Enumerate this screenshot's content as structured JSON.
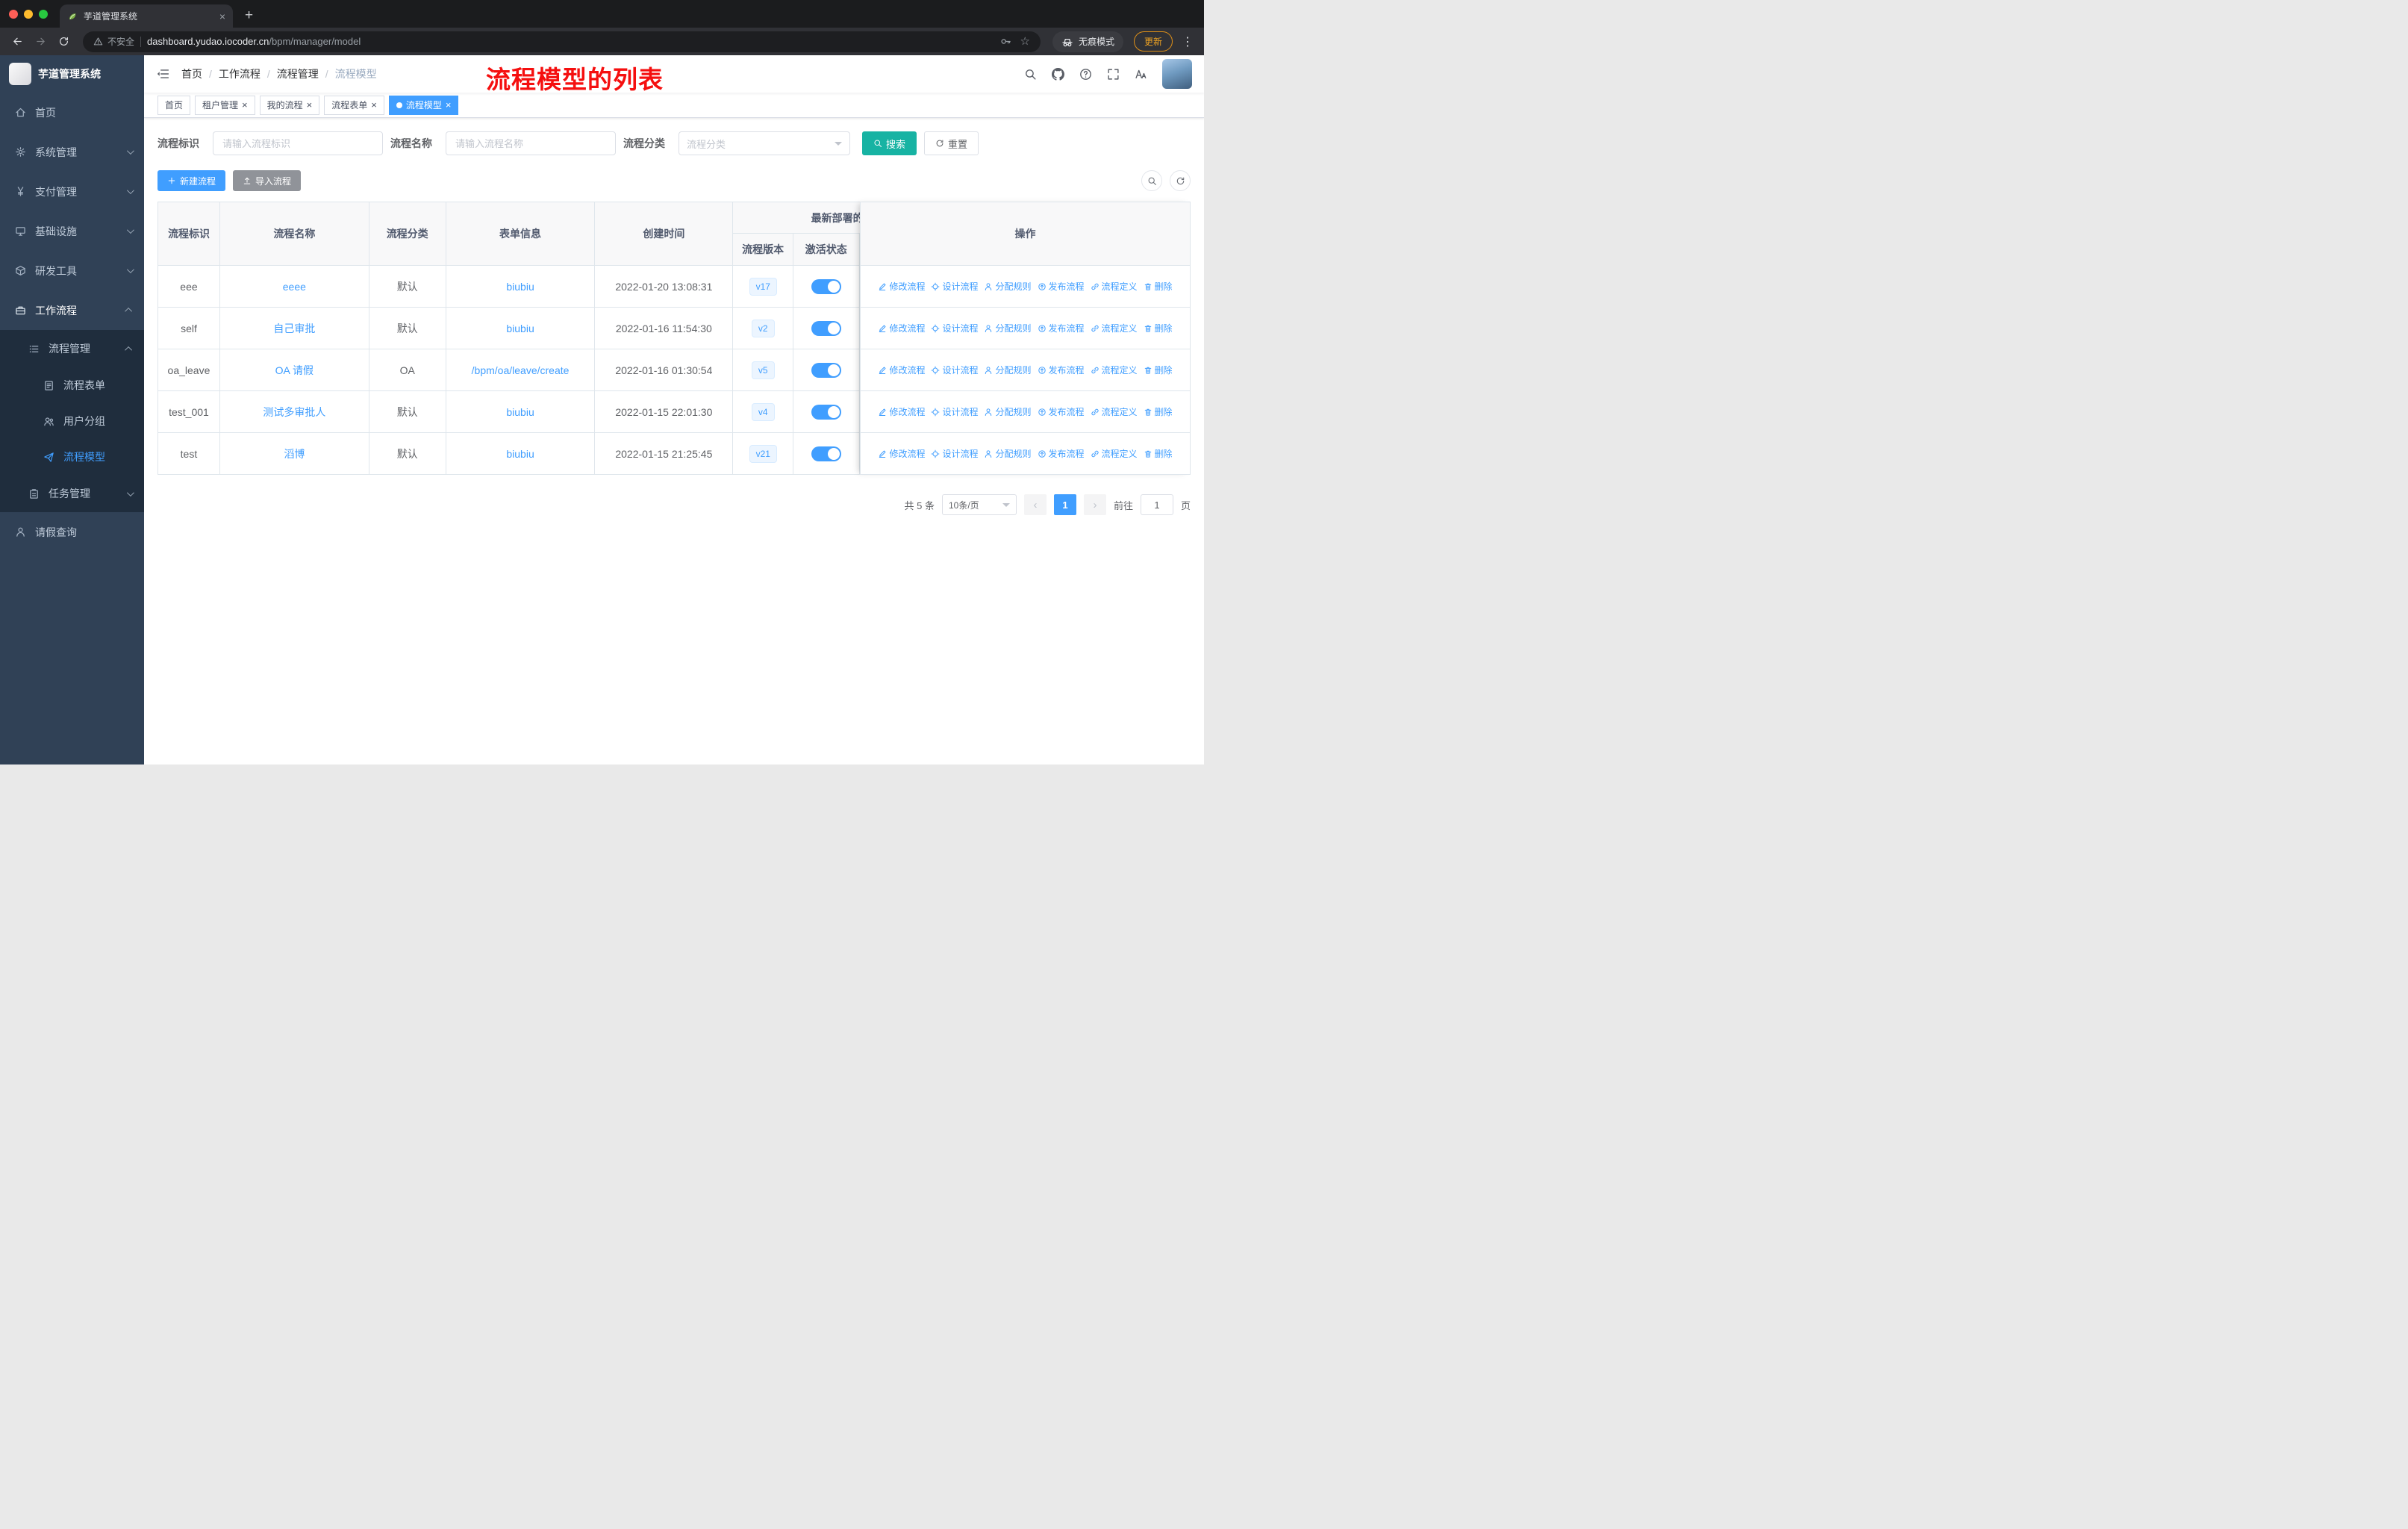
{
  "browser": {
    "tab_title": "芋道管理系统",
    "security_label": "不安全",
    "url_host": "dashboard.yudao.iocoder.cn",
    "url_path": "/bpm/manager/model",
    "incognito_label": "无痕模式",
    "update_label": "更新"
  },
  "colors": {
    "primary": "#409eff",
    "search_button": "#17b3a3",
    "annotation_red": "#f50f0f",
    "update_orange": "#f0a423",
    "sidebar_bg": "#304156",
    "submenu_bg": "#1f2d3d"
  },
  "sidebar": {
    "logo_text": "芋道管理系统",
    "menu": [
      {
        "label": "首页",
        "icon": "home",
        "level": 1
      },
      {
        "label": "系统管理",
        "icon": "gear",
        "level": 1,
        "arrow": "down"
      },
      {
        "label": "支付管理",
        "icon": "yen",
        "level": 1,
        "arrow": "down"
      },
      {
        "label": "基础设施",
        "icon": "infra",
        "level": 1,
        "arrow": "down"
      },
      {
        "label": "研发工具",
        "icon": "tools",
        "level": 1,
        "arrow": "down"
      },
      {
        "label": "工作流程",
        "icon": "work",
        "level": 1,
        "arrow": "up",
        "highlight": true
      },
      {
        "label": "流程管理",
        "icon": "list",
        "level": 2,
        "arrow": "up",
        "sub": true
      },
      {
        "label": "流程表单",
        "icon": "form",
        "level": 3,
        "sub": true
      },
      {
        "label": "用户分组",
        "icon": "users",
        "level": 3,
        "sub": true
      },
      {
        "label": "流程模型",
        "icon": "send",
        "level": 3,
        "sub": true,
        "active": true
      },
      {
        "label": "任务管理",
        "icon": "task",
        "level": 2,
        "arrow": "down",
        "sub": true
      },
      {
        "label": "请假查询",
        "icon": "person",
        "level": 1
      }
    ]
  },
  "header": {
    "breadcrumb": [
      "首页",
      "工作流程",
      "流程管理",
      "流程模型"
    ],
    "annotation": "流程模型的列表",
    "icons": [
      "search",
      "github",
      "question",
      "fullscreen",
      "fontsize"
    ]
  },
  "tags_view": [
    {
      "label": "首页"
    },
    {
      "label": "租户管理",
      "closable": true
    },
    {
      "label": "我的流程",
      "closable": true
    },
    {
      "label": "流程表单",
      "closable": true
    },
    {
      "label": "流程模型",
      "closable": true,
      "active": true
    }
  ],
  "filters": {
    "key_label": "流程标识",
    "key_placeholder": "请输入流程标识",
    "name_label": "流程名称",
    "name_placeholder": "请输入流程名称",
    "category_label": "流程分类",
    "category_placeholder": "流程分类",
    "search_label": "搜索",
    "reset_label": "重置"
  },
  "toolbar": {
    "create_label": "新建流程",
    "import_label": "导入流程"
  },
  "table": {
    "headers": {
      "key": "流程标识",
      "name": "流程名称",
      "category": "流程分类",
      "form": "表单信息",
      "created": "创建时间",
      "deploy_group": "最新部署的",
      "version": "流程版本",
      "status": "激活状态",
      "actions": "操作"
    },
    "rows": [
      {
        "key": "eee",
        "name": "eeee",
        "category": "默认",
        "form": "biubiu",
        "created": "2022-01-20 13:08:31",
        "version": "v17",
        "active": true
      },
      {
        "key": "self",
        "name": "自己审批",
        "category": "默认",
        "form": "biubiu",
        "created": "2022-01-16 11:54:30",
        "version": "v2",
        "active": true
      },
      {
        "key": "oa_leave",
        "name": "OA 请假",
        "category": "OA",
        "form": "/bpm/oa/leave/create",
        "created": "2022-01-16 01:30:54",
        "version": "v5",
        "active": true
      },
      {
        "key": "test_001",
        "name": "测试多审批人",
        "category": "默认",
        "form": "biubiu",
        "created": "2022-01-15 22:01:30",
        "version": "v4",
        "active": true
      },
      {
        "key": "test",
        "name": "滔博",
        "category": "默认",
        "form": "biubiu",
        "created": "2022-01-15 21:25:45",
        "version": "v21",
        "active": true
      }
    ],
    "row_actions": [
      {
        "label": "修改流程",
        "icon": "edit"
      },
      {
        "label": "设计流程",
        "icon": "design"
      },
      {
        "label": "分配规则",
        "icon": "assign"
      },
      {
        "label": "发布流程",
        "icon": "publish"
      },
      {
        "label": "流程定义",
        "icon": "definition"
      },
      {
        "label": "删除",
        "icon": "delete"
      }
    ]
  },
  "pagination": {
    "total_label": "共 5 条",
    "page_size_label": "10条/页",
    "current_page": "1",
    "goto_label": "前往",
    "goto_value": "1",
    "page_unit": "页"
  }
}
